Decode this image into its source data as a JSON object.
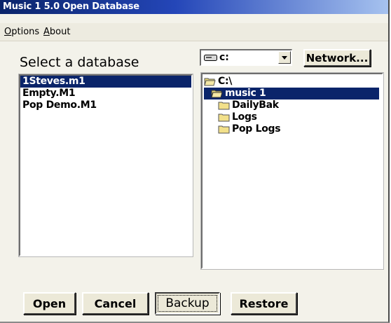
{
  "window": {
    "title": "Music 1 5.0  Open Database"
  },
  "menu": {
    "items": [
      "Options",
      "About"
    ]
  },
  "left": {
    "heading": "Select a database",
    "databases": [
      "1Steves.m1",
      "Empty.M1",
      "Pop Demo.M1"
    ],
    "selected_index": 0
  },
  "drive": {
    "value": "c:",
    "icon": "drive-icon"
  },
  "network_button": "Network...",
  "tree": {
    "items": [
      {
        "label": "C:\\",
        "icon": "open-folder-icon",
        "level": 0
      },
      {
        "label": "music 1",
        "icon": "open-folder-icon",
        "level": 1,
        "selected": true
      },
      {
        "label": "DailyBak",
        "icon": "folder-icon",
        "level": 2
      },
      {
        "label": "Logs",
        "icon": "folder-icon",
        "level": 2
      },
      {
        "label": "Pop Logs",
        "icon": "folder-icon",
        "level": 2
      }
    ]
  },
  "buttons": {
    "open": "Open",
    "cancel": "Cancel",
    "backup": "Backup",
    "restore": "Restore"
  },
  "colors": {
    "title_bar": "#0a246a",
    "selection": "#0a246a",
    "face": "#ece9d8"
  }
}
